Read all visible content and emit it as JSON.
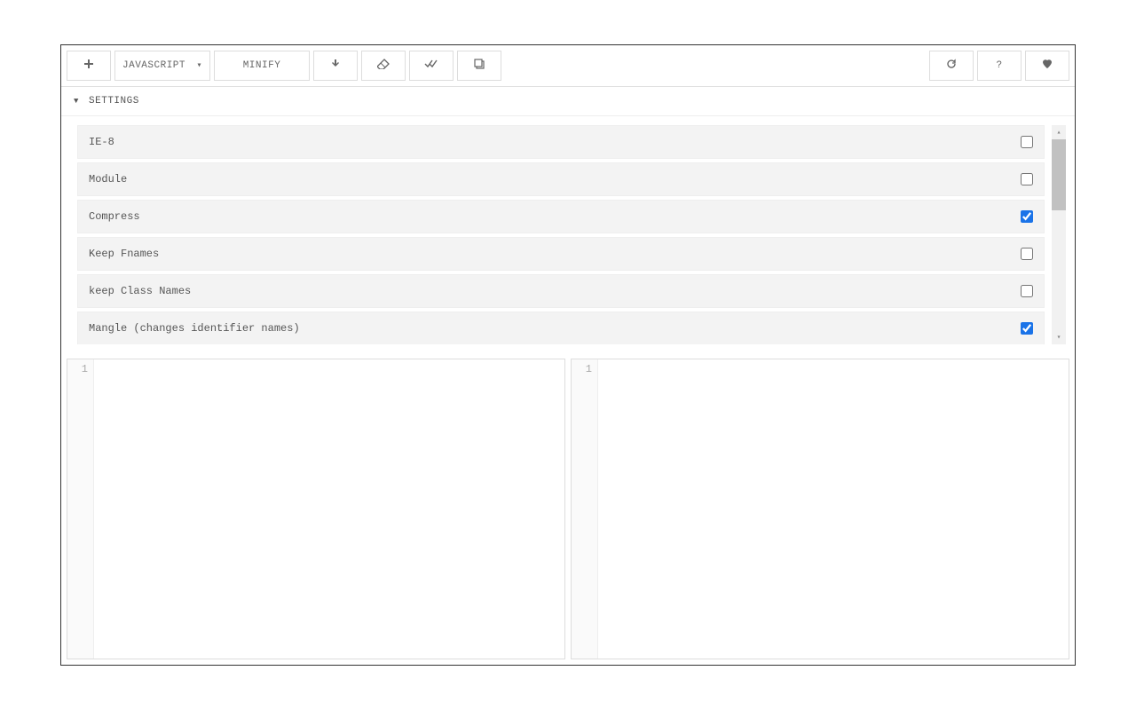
{
  "toolbar": {
    "language": "JAVASCRIPT",
    "action": "MINIFY",
    "help": "?"
  },
  "settings": {
    "title": "SETTINGS",
    "items": [
      {
        "label": "IE-8",
        "checked": false
      },
      {
        "label": "Module",
        "checked": false
      },
      {
        "label": "Compress",
        "checked": true
      },
      {
        "label": "Keep Fnames",
        "checked": false
      },
      {
        "label": "keep Class Names",
        "checked": false
      },
      {
        "label": "Mangle (changes identifier names)",
        "checked": true
      }
    ]
  },
  "editors": {
    "left_line": "1",
    "right_line": "1"
  }
}
